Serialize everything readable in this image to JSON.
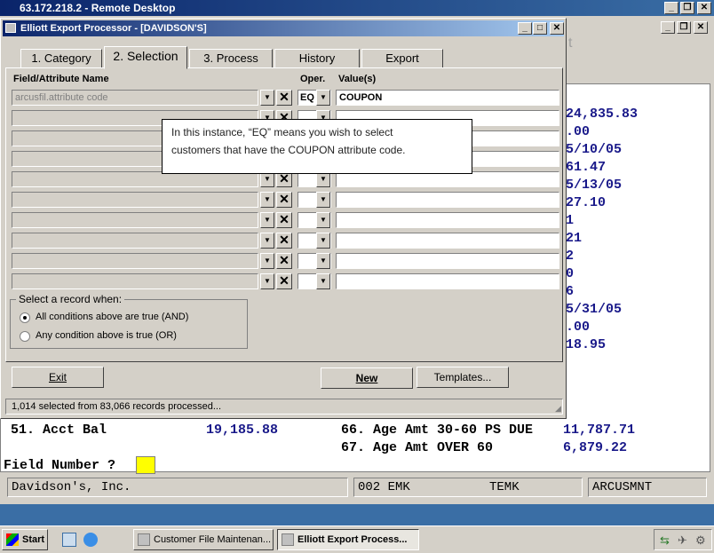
{
  "remote_desktop": {
    "title": "63.172.218.2 - Remote Desktop"
  },
  "terminal": {
    "lines_right": [
      "24,835.83",
      ".00",
      "5/10/05",
      "61.47",
      "5/13/05",
      "27.10",
      "1",
      "21",
      "2",
      "0",
      "6",
      "5/31/05",
      ".00",
      "18.95"
    ],
    "row51_label": "51. Acct Bal",
    "row51_value": "19,185.88",
    "row66_label": "66. Age Amt 30-60 PS DUE",
    "row66_value": "11,787.71",
    "row67_label": "67. Age Amt OVER 60",
    "row67_value": "6,879.22",
    "prompt": "Field Number ?",
    "status_company": "Davidson's, Inc.",
    "status_code": "002 EMK",
    "status_user": "TEMK",
    "status_program": "ARCUSMNT",
    "right_fragment": "t"
  },
  "dialog": {
    "title": "Elliott Export Processor - [DAVIDSON'S]",
    "tabs": [
      {
        "label": "1. Category",
        "active": false
      },
      {
        "label": "2. Selection",
        "active": true
      },
      {
        "label": "3. Process",
        "active": false
      },
      {
        "label": "History",
        "active": false
      },
      {
        "label": "Export",
        "active": false
      }
    ],
    "col_field": "Field/Attribute Name",
    "col_oper": "Oper.",
    "col_values": "Value(s)",
    "row1_field": "arcusfil.attribute code",
    "row1_oper": "EQ",
    "row1_value": "COUPON",
    "group_title": "Select a record when:",
    "radio_and": "All conditions above are true (AND)",
    "radio_or": "Any condition above is true (OR)",
    "exit_label": "Exit",
    "new_label": "New",
    "templates_label": "Templates...",
    "status": "1,014 selected from 83,066 records processed..."
  },
  "tooltip": {
    "line1": "In this instance, “EQ” means you wish to select",
    "line2": "customers that have the COUPON attribute code."
  },
  "taskbar": {
    "start": "Start",
    "task1": "Customer File Maintenan...",
    "task2": "Elliott Export Process..."
  }
}
